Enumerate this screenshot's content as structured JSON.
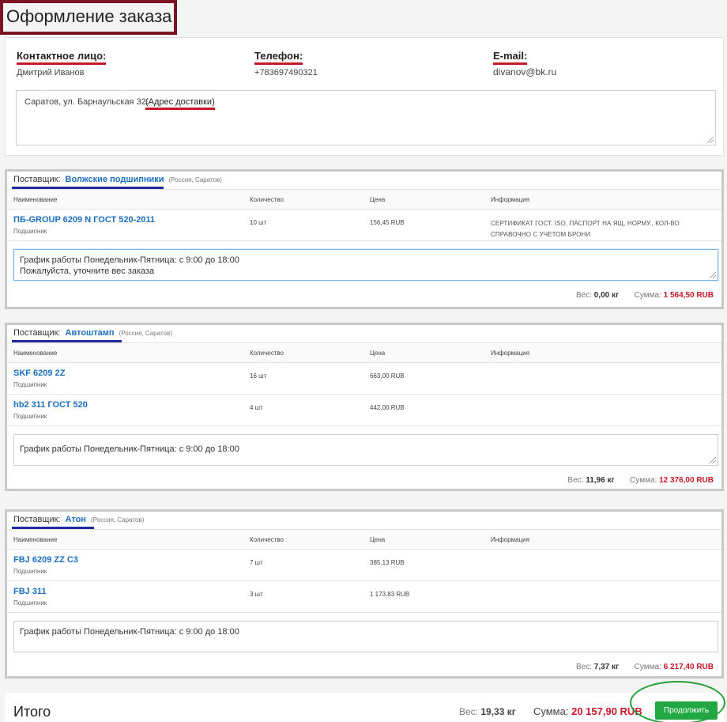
{
  "page": {
    "title": "Оформление заказа"
  },
  "contact": {
    "person_label": "Контактное лицо:",
    "person_value": "Дмитрий Иванов",
    "phone_label": "Телефон:",
    "phone_value": "+783697490321",
    "email_label": "E-mail:",
    "email_value": "divanov@bk.ru",
    "address_value": "Саратов, ул. Барнаульская 32.",
    "address_hint": "(Адрес доставки)"
  },
  "table_headers": {
    "name": "Наименование",
    "qty": "Количество",
    "price": "Цена",
    "info": "Информация"
  },
  "suppliers": [
    {
      "label": "Поставщик:",
      "name": "Волжские подшипники",
      "region": "(Россия, Саратов)",
      "items": [
        {
          "name": "ПБ-GROUP 6209 N ГОСТ 520-2011",
          "type": "Подшипник",
          "qty": "10 шт",
          "price": "156,45 RUB",
          "info": "СЕРТИФИКАТ ГОСТ, ISO, ПАСПОРТ НА ЯЩ, НОРМУ., КОЛ-ВО СПРАВОЧНО С УЧЕТОМ БРОНИ"
        }
      ],
      "comment_line1": "График работы  Понедельник-Пятница: с 9:00 до 18:00",
      "comment_line2": "Пожалуйста, уточните вес заказа",
      "weight_label": "Вес:",
      "weight": "0,00 кг",
      "sum_label": "Сумма:",
      "sum": "1 564,50 RUB"
    },
    {
      "label": "Поставщик:",
      "name": "Автоштамп",
      "region": "(Россия, Саратов)",
      "items": [
        {
          "name": "SKF 6209 2Z",
          "type": "Подшипник",
          "qty": "16 шт",
          "price": "663,00 RUB",
          "info": ""
        },
        {
          "name": "hb2 311 ГОСТ 520",
          "type": "Подшипник",
          "qty": "4 шт",
          "price": "442,00 RUB",
          "info": ""
        }
      ],
      "comment_line1": "График работы  Понедельник-Пятница: с 9:00 до 18:00",
      "weight_label": "Вес:",
      "weight": "11,96 кг",
      "sum_label": "Сумма:",
      "sum": "12 376,00 RUB"
    },
    {
      "label": "Поставщик:",
      "name": "Атон",
      "region": "(Россия, Саратов)",
      "items": [
        {
          "name": "FBJ 6209 ZZ C3",
          "type": "Подшипник",
          "qty": "7 шт",
          "price": "385,13 RUB",
          "info": ""
        },
        {
          "name": "FBJ 311",
          "type": "Подшипник",
          "qty": "3 шт",
          "price": "1 173,83 RUB",
          "info": ""
        }
      ],
      "comment_line1": "График работы  Понедельник-Пятница: с 9:00 до 18:00",
      "weight_label": "Вес:",
      "weight": "7,37 кг",
      "sum_label": "Сумма:",
      "sum": "6 217,40 RUB"
    }
  ],
  "total": {
    "title": "Итого",
    "weight_label": "Вес:",
    "weight": "19,33 кг",
    "sum_label": "Сумма:",
    "sum": "20 157,90 RUB",
    "continue_label": "Продолжить"
  },
  "colors": {
    "accent_red": "#c8182a",
    "link_blue": "#1c6fc1",
    "button_green": "#22a843",
    "header_border": "#7a1424"
  }
}
